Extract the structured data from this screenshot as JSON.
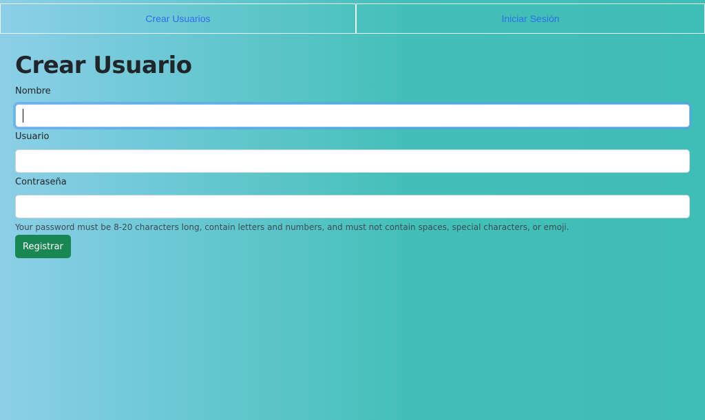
{
  "nav": {
    "tabs": [
      {
        "label": "Crear Usuarios"
      },
      {
        "label": "Iniciar Sesión"
      }
    ]
  },
  "form": {
    "title": "Crear Usuario",
    "fields": [
      {
        "label": "Nombre",
        "value": "",
        "placeholder": ""
      },
      {
        "label": "Usuario",
        "value": "",
        "placeholder": ""
      },
      {
        "label": "Contraseña",
        "value": "",
        "placeholder": ""
      }
    ],
    "help_text": "Your password must be 8-20 characters long, contain letters and numbers, and must not contain spaces, special characters, or emoji.",
    "submit_label": "Registrar"
  },
  "colors": {
    "link": "#2f6de8",
    "button": "#198754",
    "background_start": "#8dcfe7",
    "background_end": "#3fbeb6"
  }
}
